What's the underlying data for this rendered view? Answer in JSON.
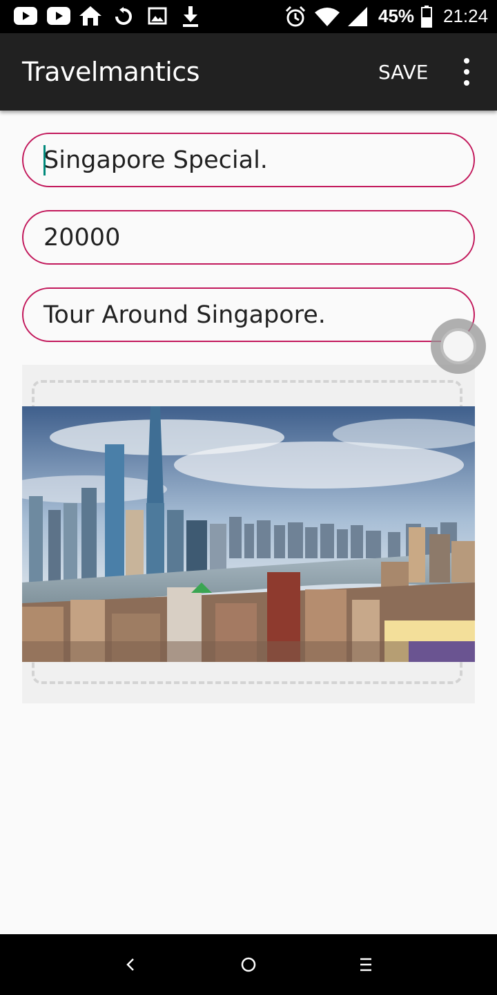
{
  "status_bar": {
    "battery": "45%",
    "time": "21:24",
    "icons": [
      "youtube-icon",
      "youtube-icon",
      "home-icon",
      "sync-icon",
      "gallery-icon",
      "download-icon",
      "alarm-icon",
      "wifi-icon",
      "signal-icon",
      "battery-icon"
    ]
  },
  "app_bar": {
    "title": "Travelmantics",
    "save_label": "SAVE",
    "overflow_icon": "more-vert-icon"
  },
  "form": {
    "title_value": "Singapore Special.",
    "price_value": "20000",
    "description_value": "Tour Around Singapore."
  },
  "image": {
    "alt": "city-skyline-photo"
  },
  "nav_bar": {
    "icons": [
      "back-icon",
      "home-circle-icon",
      "recents-icon"
    ]
  },
  "colors": {
    "app_bar": "#212121",
    "field_border": "#c2185b",
    "caret": "#00897b",
    "background": "#fafafa"
  }
}
